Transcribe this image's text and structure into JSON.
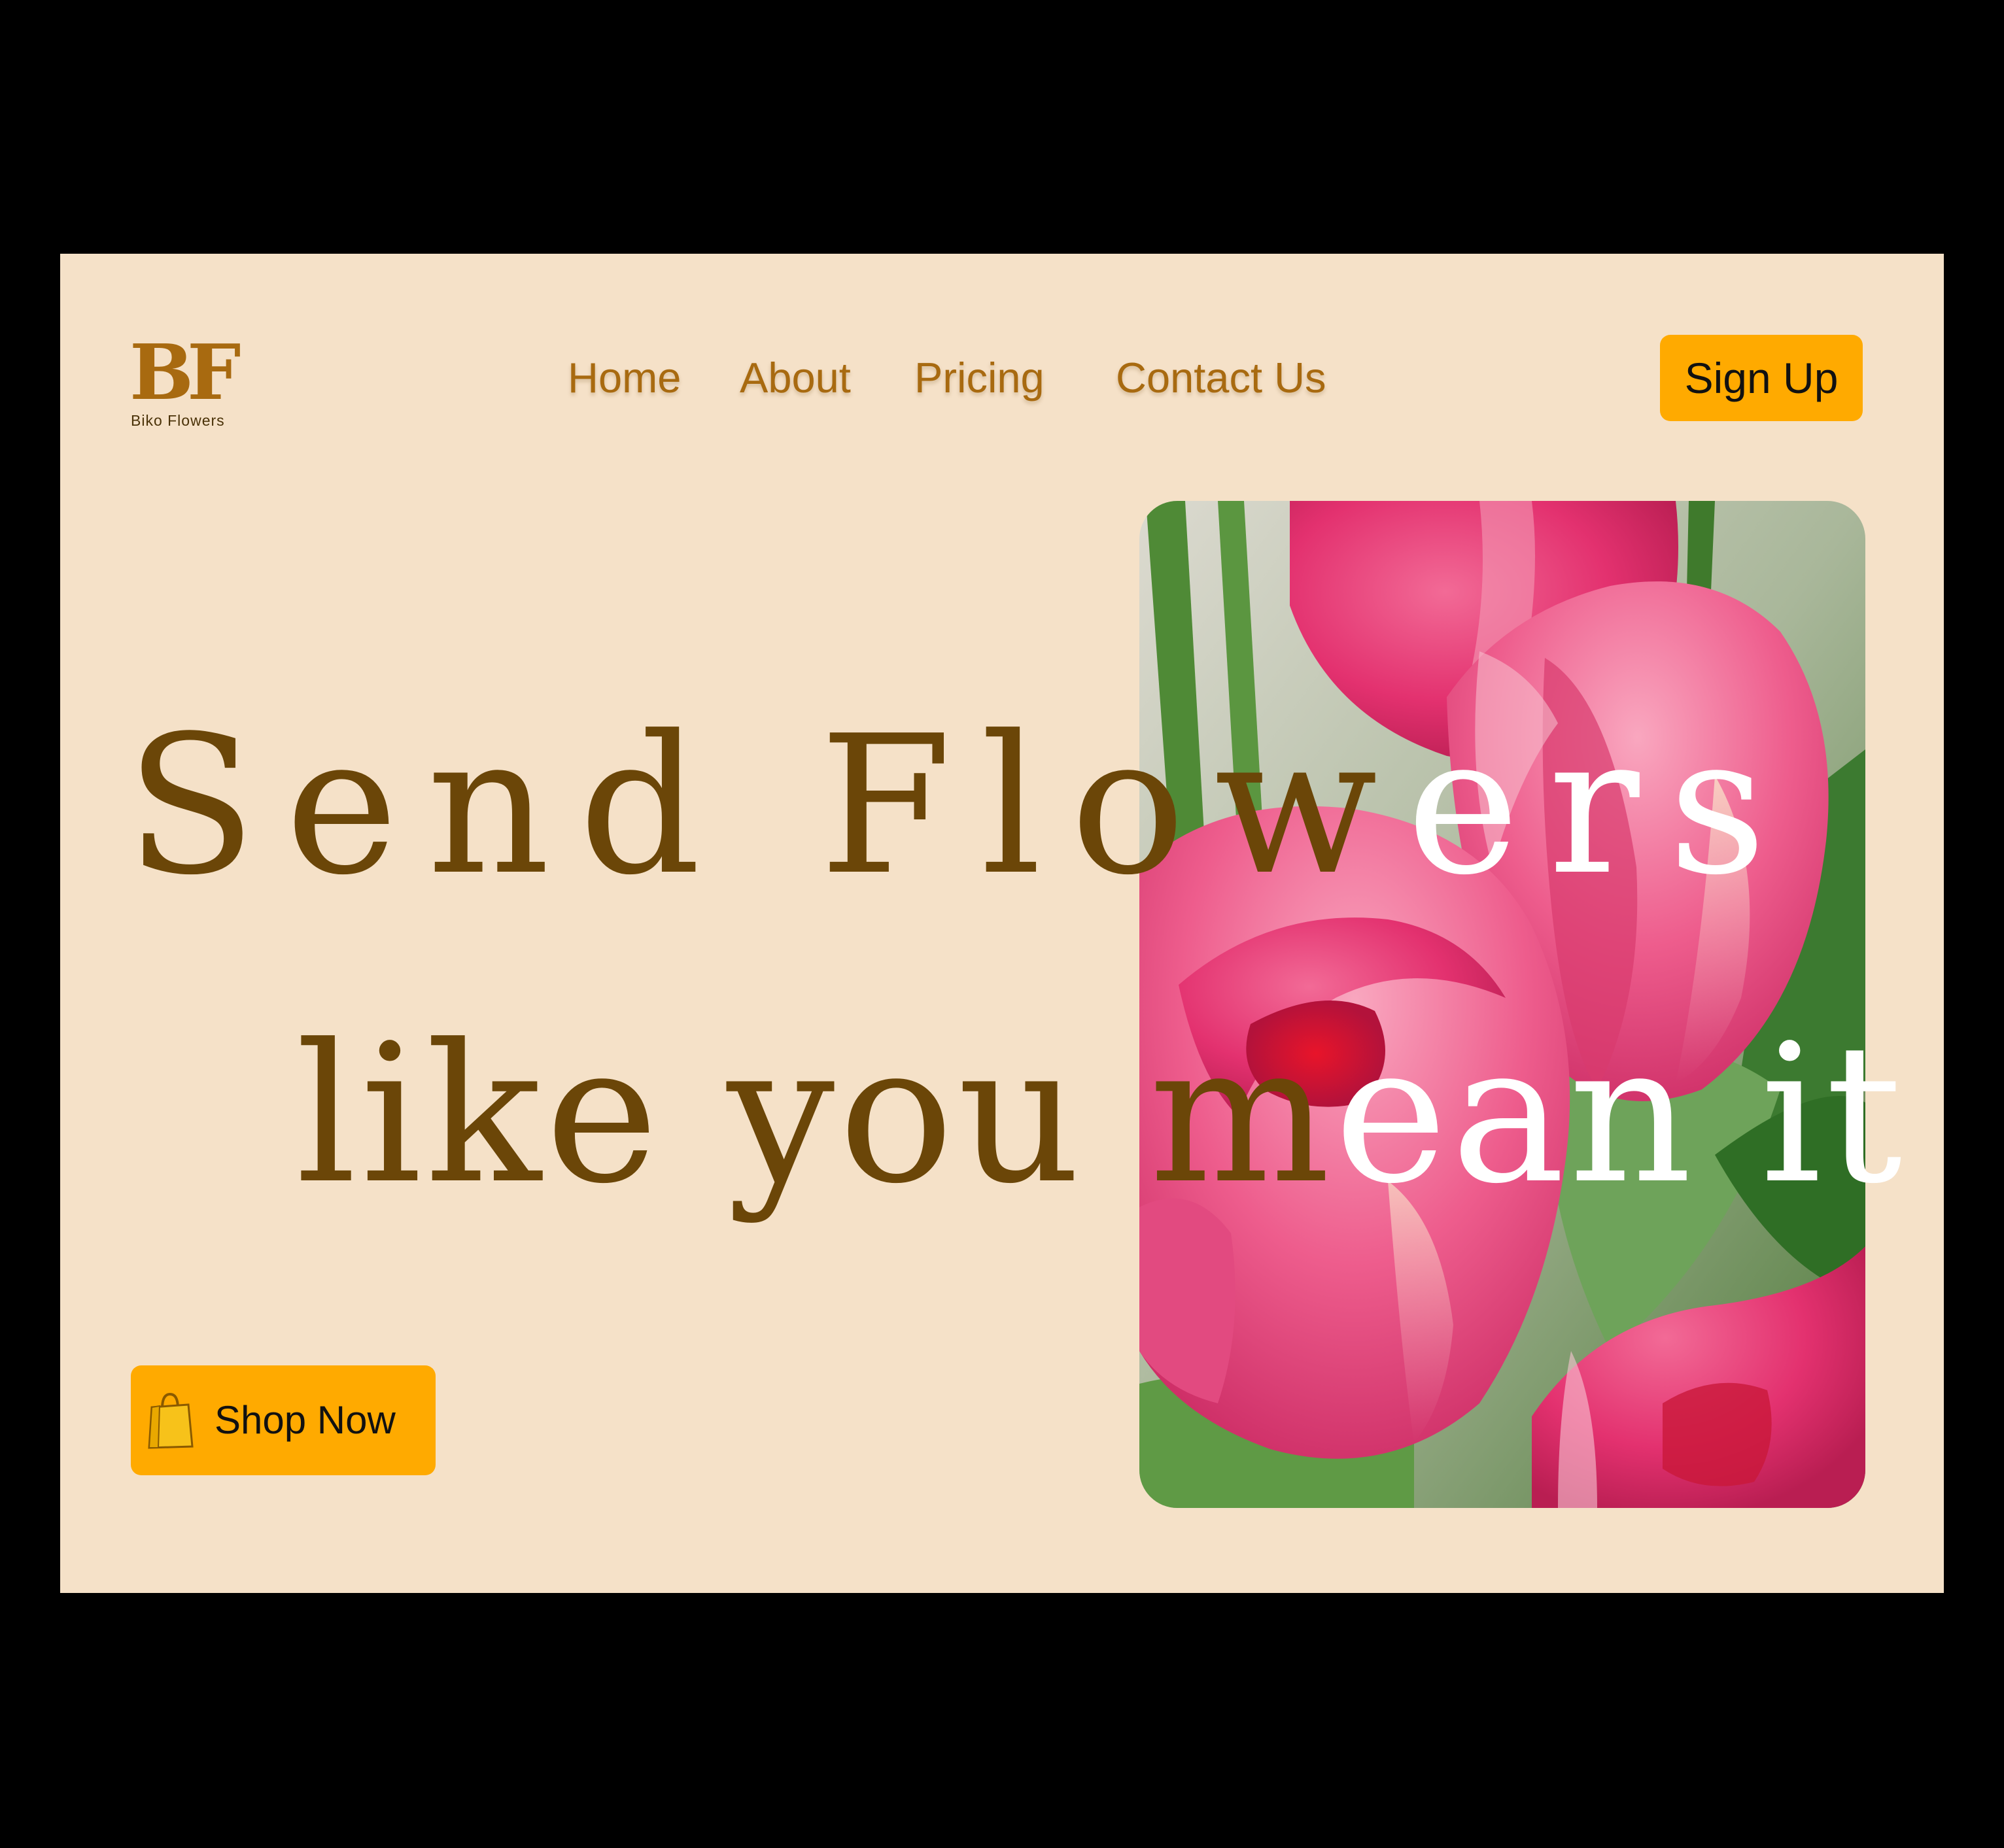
{
  "brand": {
    "logo_mark": "BF",
    "name": "Biko Flowers"
  },
  "nav": {
    "items": [
      {
        "label": "Home"
      },
      {
        "label": "About"
      },
      {
        "label": "Pricing"
      },
      {
        "label": "Contact Us"
      }
    ]
  },
  "header": {
    "signup_label": "Sign Up"
  },
  "hero": {
    "headline_line1_dark": "Send Flow",
    "headline_line1_light": "ers",
    "headline_line2_dark": "like you m",
    "headline_line2_light": "ean it",
    "image_subject": "pink tulips",
    "shop_button_label": "Shop Now",
    "shop_button_icon": "shopping-bag-icon"
  },
  "colors": {
    "page_background": "#f5e1c8",
    "brand_brown": "#a86a10",
    "headline_brown": "#6b4608",
    "accent_orange": "#ffaa00",
    "outer_background": "#000000"
  }
}
